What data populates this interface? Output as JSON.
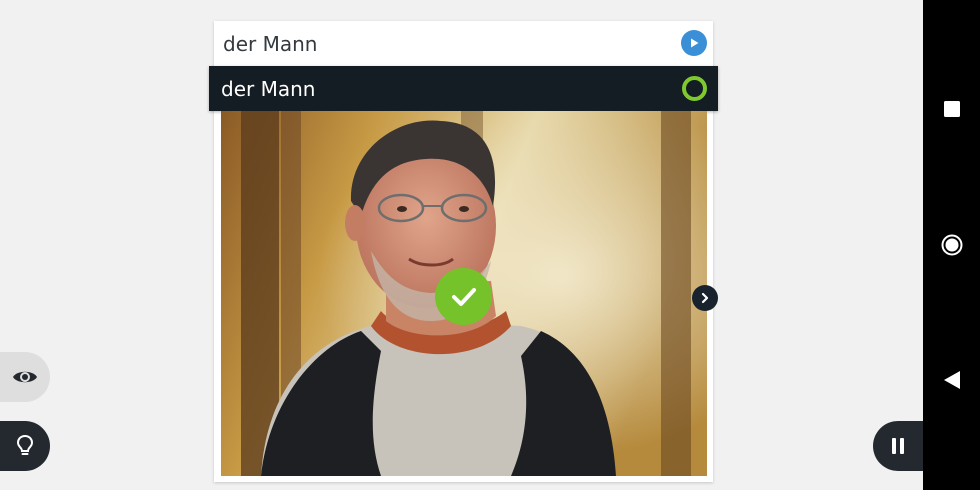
{
  "prompt": {
    "word": "der Mann",
    "audio_icon": "play-icon"
  },
  "answer": {
    "word": "der Mann",
    "status_icon": "progress-ring-icon",
    "status_color": "#7fc92f"
  },
  "image": {
    "icon": "photo-man-icon"
  },
  "feedback": {
    "icon": "checkmark-icon",
    "color": "#76c22b"
  },
  "controls": {
    "next_icon": "chevron-right-icon",
    "eye_icon": "eye-icon",
    "hint_icon": "lightbulb-icon",
    "pause_icon": "pause-icon"
  },
  "system_nav": {
    "recents_icon": "square-icon",
    "home_icon": "circle-icon",
    "back_icon": "triangle-back-icon"
  }
}
